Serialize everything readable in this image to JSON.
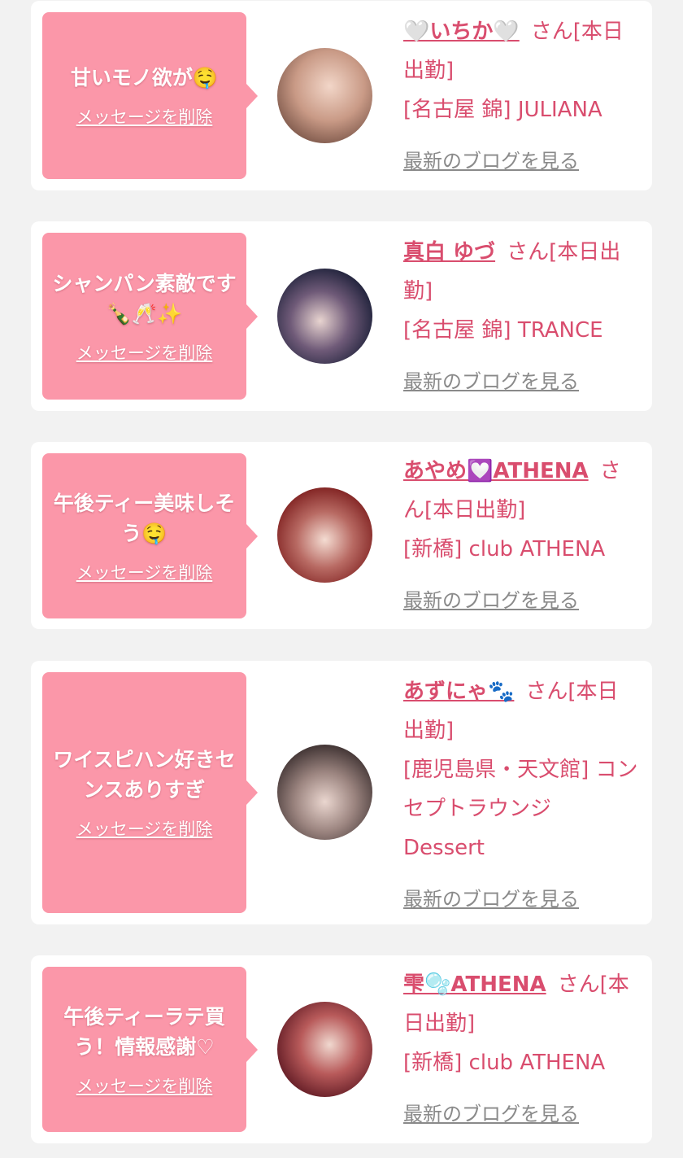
{
  "colors": {
    "background": "#f2f2f2",
    "bubble": "#fb97a9",
    "accent_text": "#d94d6e",
    "link_gray": "#8a8a8a"
  },
  "messages": [
    {
      "message": "甘いモノ欲が🤤",
      "delete_label": "メッセージを削除",
      "name": "🤍いちか🤍",
      "honorific": "さん[本日出勤]",
      "shop": "[名古屋 錦] JULIANA",
      "blog_label": "最新のブログを見る",
      "avatar": "avatar-photo"
    },
    {
      "message": "シャンパン素敵です🍾🥂✨",
      "delete_label": "メッセージを削除",
      "name": "真白 ゆづ",
      "honorific": "さん[本日出勤]",
      "shop": "[名古屋 錦] TRANCE",
      "blog_label": "最新のブログを見る",
      "avatar": "avatar-photo"
    },
    {
      "message": "午後ティー美味しそう🤤",
      "delete_label": "メッセージを削除",
      "name": "あやめ💟ATHENA",
      "honorific": "さん[本日出勤]",
      "shop": "[新橋] club ATHENA",
      "blog_label": "最新のブログを見る",
      "avatar": "avatar-photo"
    },
    {
      "message": "ワイスピハン好きセンスありすぎ",
      "delete_label": "メッセージを削除",
      "name": "あずにゃ🐾",
      "honorific": "さん[本日出勤]",
      "shop": "[鹿児島県・天文館] コンセプトラウンジ Dessert",
      "blog_label": "最新のブログを見る",
      "avatar": "avatar-photo"
    },
    {
      "message": "午後ティーラテ買う！情報感謝♡",
      "delete_label": "メッセージを削除",
      "name": "雫🫧ATHENA",
      "honorific": "さん[本日出勤]",
      "shop": "[新橋] club ATHENA",
      "blog_label": "最新のブログを見る",
      "avatar": "avatar-photo"
    }
  ]
}
